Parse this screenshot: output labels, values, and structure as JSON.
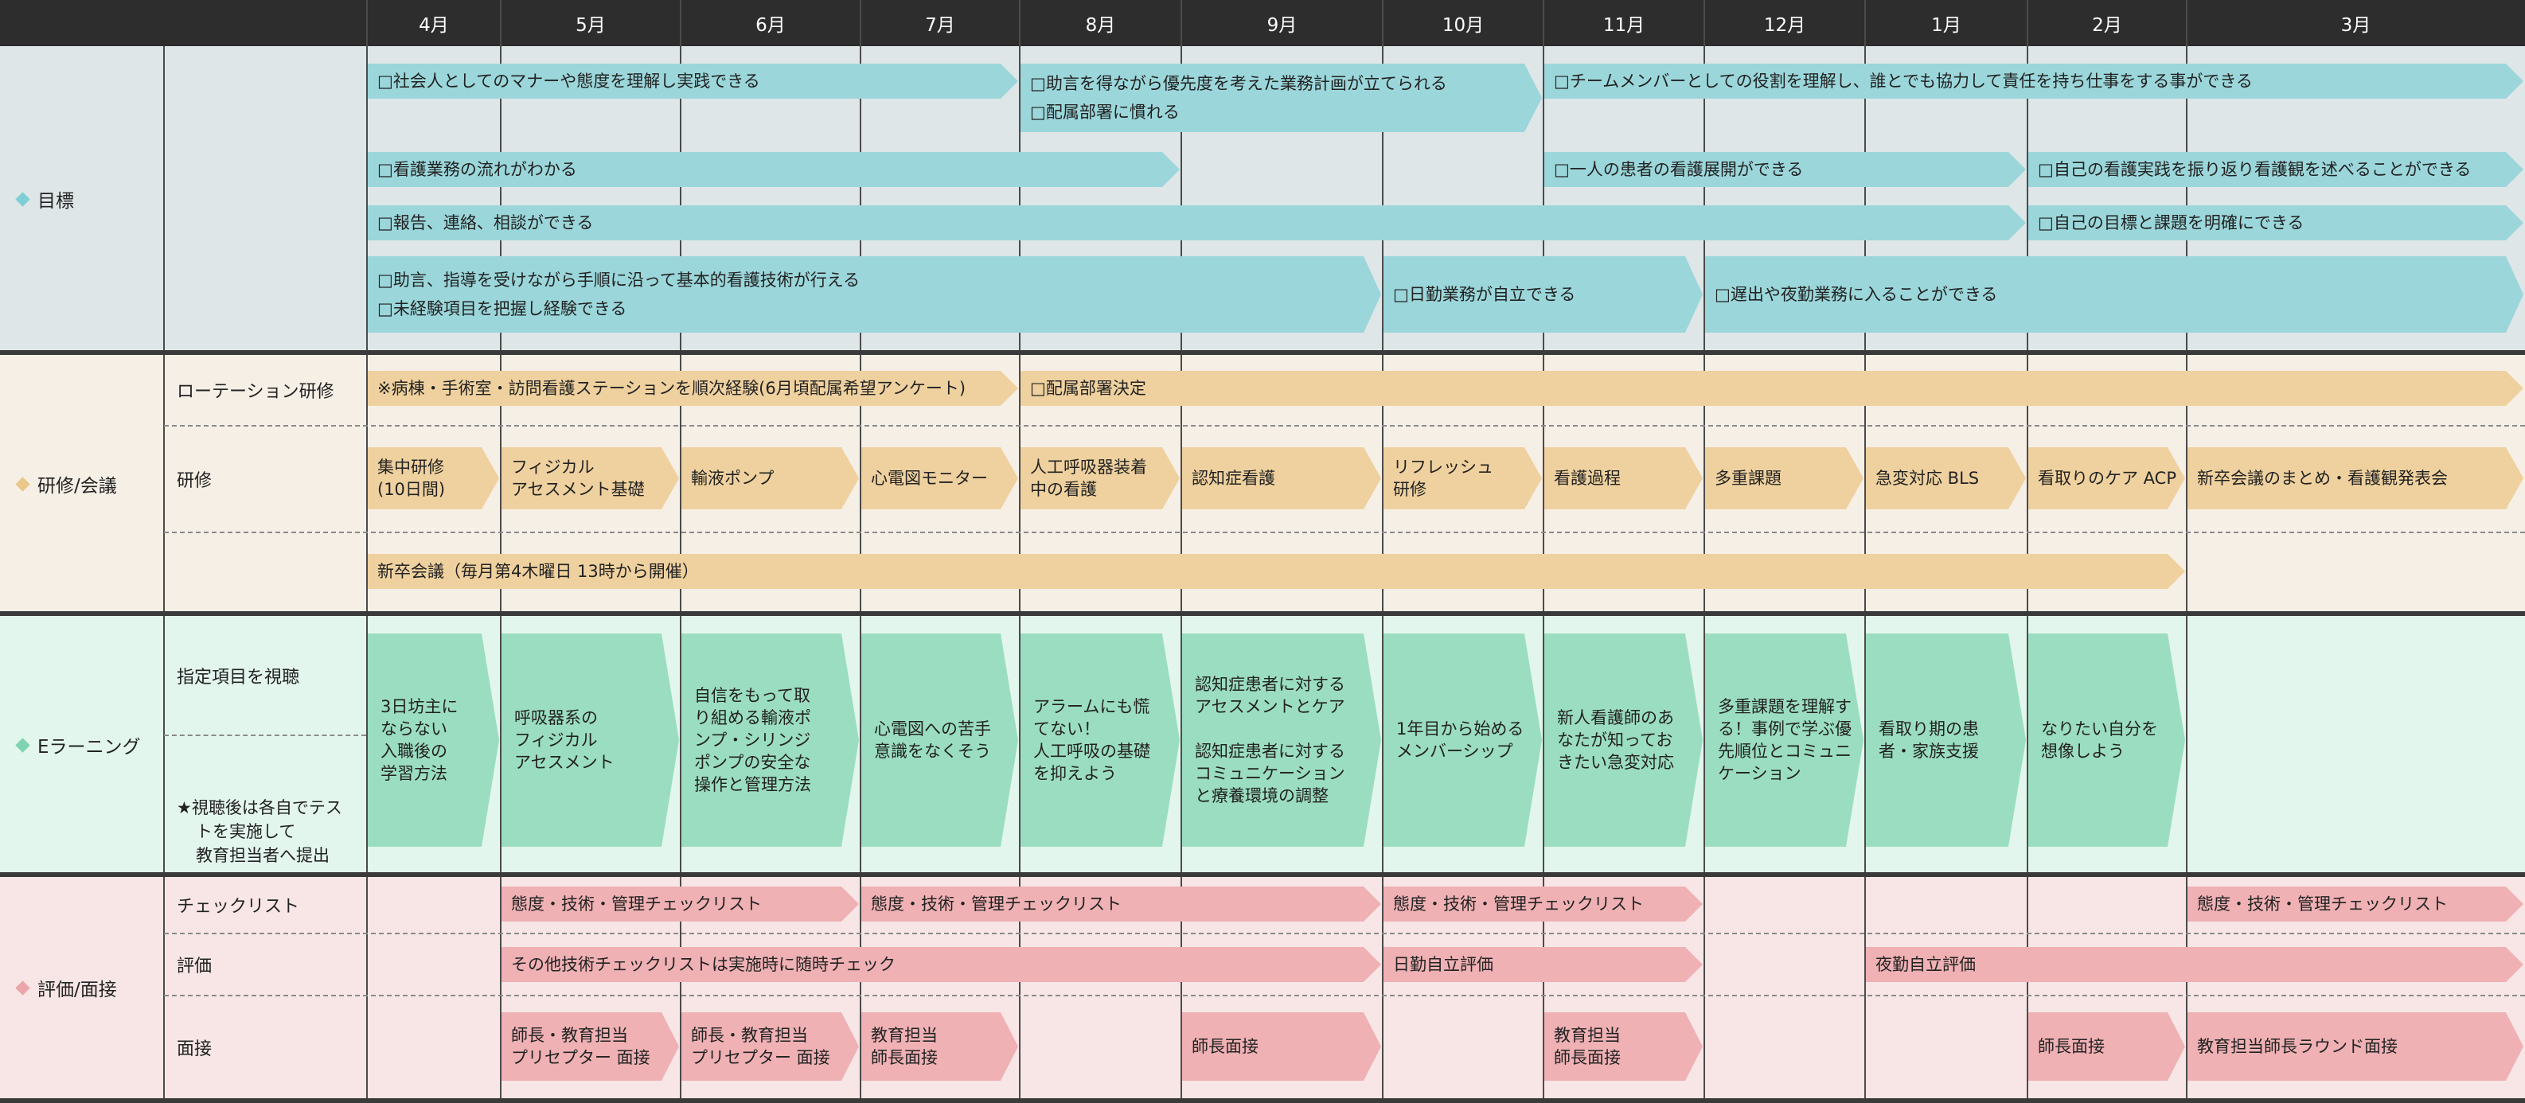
{
  "months": [
    "4月",
    "5月",
    "6月",
    "7月",
    "8月",
    "9月",
    "10月",
    "11月",
    "12月",
    "1月",
    "2月",
    "3月"
  ],
  "colors": {
    "header": "#2d2d2d",
    "goal_bg": "#dfe6e8",
    "goal_bar": "#9bd6da",
    "goal_diamond": "#7fcfd6",
    "training_bg": "#f6efe6",
    "training_bar": "#efd19f",
    "training_diamond": "#eac88b",
    "elearning_bg": "#e3f6ee",
    "elearning_bar": "#9bddc0",
    "elearning_diamond": "#7fd3b0",
    "eval_bg": "#f8e6e6",
    "eval_bar": "#efb1b4",
    "eval_diamond": "#eaa6aa"
  },
  "sections": {
    "goals": {
      "label": "目標",
      "rows": [
        [
          {
            "lines": [
              "□社会人としてのマナーや態度を理解し実践できる"
            ],
            "from": 0,
            "to": 4
          },
          {
            "lines": [
              "□助言を得ながら優先度を考えた業務計画が立てられる",
              "□配属部署に慣れる"
            ],
            "from": 4,
            "to": 7
          },
          {
            "lines": [
              "□チームメンバーとしての役割を理解し、誰とでも協力して責任を持ち仕事をする事ができる"
            ],
            "from": 7,
            "to": 12
          }
        ],
        [
          {
            "lines": [
              "□看護業務の流れがわかる"
            ],
            "from": 0,
            "to": 5
          },
          {
            "lines": [
              "□一人の患者の看護展開ができる"
            ],
            "from": 7,
            "to": 10
          },
          {
            "lines": [
              "□自己の看護実践を振り返り看護観を述べることができる"
            ],
            "from": 10,
            "to": 12
          }
        ],
        [
          {
            "lines": [
              "□報告、連絡、相談ができる"
            ],
            "from": 0,
            "to": 10
          },
          {
            "lines": [
              "□自己の目標と課題を明確にできる"
            ],
            "from": 10,
            "to": 12
          }
        ],
        [
          {
            "lines": [
              "□助言、指導を受けながら手順に沿って基本的看護技術が行える",
              "□未経験項目を把握し経験できる"
            ],
            "from": 0,
            "to": 6
          },
          {
            "lines": [
              "□日勤業務が自立できる"
            ],
            "from": 6,
            "to": 8
          },
          {
            "lines": [
              "□遅出や夜勤業務に入ることができる"
            ],
            "from": 8,
            "to": 12
          }
        ]
      ]
    },
    "training": {
      "label": "研修/会議",
      "rotation_label": "ローテーション研修",
      "training_label": "研修",
      "rotation": [
        {
          "lines": [
            "※病棟・手術室・訪問看護ステーションを順次経験(6月頃配属希望アンケート)"
          ],
          "from": 0,
          "to": 4
        },
        {
          "lines": [
            "□配属部署決定"
          ],
          "from": 4,
          "to": 12
        }
      ],
      "courses": [
        {
          "lines": [
            "集中研修",
            "(10日間)"
          ],
          "from": 0,
          "to": 1
        },
        {
          "lines": [
            "フィジカル",
            "アセスメント基礎"
          ],
          "from": 1,
          "to": 2
        },
        {
          "lines": [
            "輸液ポンプ"
          ],
          "from": 2,
          "to": 3
        },
        {
          "lines": [
            "心電図モニター"
          ],
          "from": 3,
          "to": 4
        },
        {
          "lines": [
            "人工呼吸器装着",
            "中の看護"
          ],
          "from": 4,
          "to": 5
        },
        {
          "lines": [
            "認知症看護"
          ],
          "from": 5,
          "to": 6
        },
        {
          "lines": [
            "リフレッシュ",
            "研修"
          ],
          "from": 6,
          "to": 7
        },
        {
          "lines": [
            "看護過程"
          ],
          "from": 7,
          "to": 8
        },
        {
          "lines": [
            "多重課題"
          ],
          "from": 8,
          "to": 9
        },
        {
          "lines": [
            "急変対応 BLS"
          ],
          "from": 9,
          "to": 10
        },
        {
          "lines": [
            "看取りのケア ACP"
          ],
          "from": 10,
          "to": 11
        },
        {
          "lines": [
            "新卒会議のまとめ・看護観発表会"
          ],
          "from": 11,
          "to": 12
        }
      ],
      "meeting": [
        {
          "lines": [
            "新卒会議（毎月第4木曜日 13時から開催）"
          ],
          "from": 0,
          "to": 11
        }
      ]
    },
    "elearning": {
      "label": "Eラーニング",
      "view_label": "指定項目を視聴",
      "note_lines": [
        "★視聴後は各自でテス",
        "トを実施して",
        "教育担当者へ提出"
      ],
      "items": [
        {
          "lines": [
            "3日坊主に",
            "ならない",
            "入職後の",
            "学習方法"
          ]
        },
        {
          "lines": [
            "呼吸器系の",
            "フィジカル",
            "アセスメント"
          ]
        },
        {
          "lines": [
            "自信をもって取",
            "り組める輸液ポ",
            "ンプ・シリンジ",
            "ポンプの安全な",
            "操作と管理方法"
          ]
        },
        {
          "lines": [
            "心電図への苦手",
            "意識をなくそう"
          ]
        },
        {
          "lines": [
            "アラームにも慌",
            "てない！",
            "人工呼吸の基礎",
            "を抑えよう"
          ]
        },
        {
          "lines": [
            "認知症患者に対する",
            "アセスメントとケア",
            "",
            "認知症患者に対する",
            "コミュニケーション",
            "と療養環境の調整"
          ]
        },
        {
          "lines": [
            "1年目から始める",
            "メンバーシップ"
          ]
        },
        {
          "lines": [
            "新人看護師のあ",
            "なたが知ってお",
            "きたい急変対応"
          ]
        },
        {
          "lines": [
            "多重課題を理解す",
            "る！事例で学ぶ優",
            "先順位とコミュニ",
            "ケーション"
          ]
        },
        {
          "lines": [
            "看取り期の患",
            "者・家族支援"
          ]
        },
        {
          "lines": [
            "なりたい自分を",
            "想像しよう"
          ]
        }
      ]
    },
    "evaluation": {
      "label": "評価/面接",
      "checklist_label": "チェックリスト",
      "eval_label": "評価",
      "interview_label": "面接",
      "checklist": [
        {
          "lines": [
            "態度・技術・管理チェックリスト"
          ],
          "from": 1,
          "to": 3
        },
        {
          "lines": [
            "態度・技術・管理チェックリスト"
          ],
          "from": 3,
          "to": 6
        },
        {
          "lines": [
            "態度・技術・管理チェックリスト"
          ],
          "from": 6,
          "to": 8
        },
        {
          "lines": [
            "態度・技術・管理チェックリスト"
          ],
          "from": 11,
          "to": 12
        }
      ],
      "evals": [
        {
          "lines": [
            "その他技術チェックリストは実施時に随時チェック"
          ],
          "from": 1,
          "to": 6
        },
        {
          "lines": [
            "日勤自立評価"
          ],
          "from": 6,
          "to": 8
        },
        {
          "lines": [
            "夜勤自立評価"
          ],
          "from": 9,
          "to": 12
        }
      ],
      "interviews": [
        {
          "lines": [
            "師長・教育担当",
            "プリセプター 面接"
          ],
          "from": 1,
          "to": 2
        },
        {
          "lines": [
            "師長・教育担当",
            "プリセプター 面接"
          ],
          "from": 2,
          "to": 3
        },
        {
          "lines": [
            "教育担当",
            "師長面接"
          ],
          "from": 3,
          "to": 4
        },
        {
          "lines": [
            "師長面接"
          ],
          "from": 5,
          "to": 6
        },
        {
          "lines": [
            "教育担当",
            "師長面接"
          ],
          "from": 7,
          "to": 8
        },
        {
          "lines": [
            "師長面接"
          ],
          "from": 10,
          "to": 11
        },
        {
          "lines": [
            "教育担当師長ラウンド面接"
          ],
          "from": 11,
          "to": 12
        }
      ]
    }
  }
}
